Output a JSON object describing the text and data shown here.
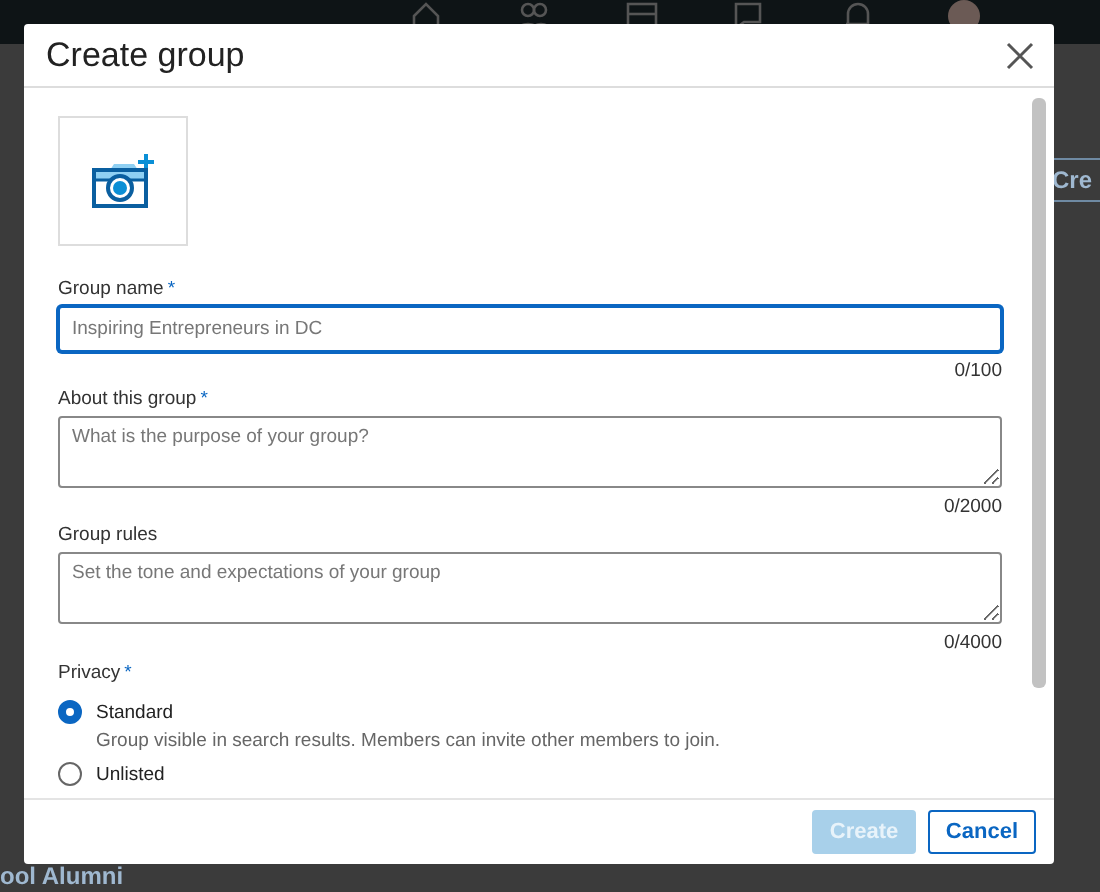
{
  "backdrop": {
    "bottom_item": "ool Alumni",
    "create_button": "Cre"
  },
  "dialog": {
    "title": "Create group",
    "fields": [
      {
        "label": "Group name",
        "required_mark": "*",
        "kind": "input",
        "placeholder": "Inspiring Entrepreneurs in DC",
        "focused": true,
        "counter": "0/100"
      },
      {
        "label": "About this group",
        "required_mark": "*",
        "kind": "textarea",
        "placeholder": "What is the purpose of your group?",
        "focused": false,
        "counter": "0/2000"
      },
      {
        "label": "Group rules",
        "kind": "textarea",
        "placeholder": "Set the tone and expectations of your group",
        "focused": false,
        "counter": "0/4000"
      }
    ],
    "privacy": {
      "label": "Privacy",
      "required_mark": "*",
      "options": [
        {
          "label": "Standard",
          "description": "Group visible in search results. Members can invite other members to join.",
          "selected": true
        },
        {
          "label": "Unlisted",
          "selected": false
        }
      ]
    },
    "buttons": [
      {
        "label": "Create",
        "kind": "primary",
        "disabled": true
      },
      {
        "label": "Cancel",
        "kind": "secondary",
        "disabled": false
      }
    ]
  }
}
